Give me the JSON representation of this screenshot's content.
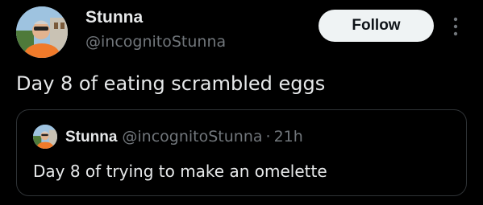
{
  "author": {
    "name": "Stunna",
    "handle": "@incognitoStunna"
  },
  "follow_label": "Follow",
  "tweet_text": "Day 8 of eating scrambled eggs",
  "quoted": {
    "name": "Stunna",
    "handle": "@incognitoStunna",
    "separator": "·",
    "time": "21h",
    "text": "Day 8 of trying to make an omelette"
  },
  "icons": {
    "more": "more-vertical-icon",
    "avatar": "avatar"
  },
  "colors": {
    "background": "#000000",
    "text_primary": "#e7e9ea",
    "text_secondary": "#71767b",
    "border": "#2f3336",
    "button_bg": "#eff3f4",
    "button_text": "#0f1419"
  }
}
